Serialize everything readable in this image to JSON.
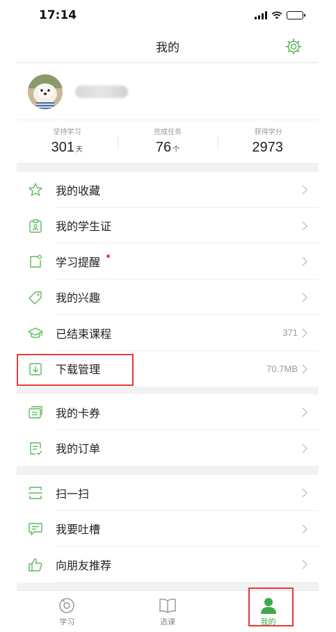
{
  "status_bar": {
    "time": "17:14"
  },
  "header": {
    "title": "我的"
  },
  "stats": [
    {
      "label": "坚持学习",
      "value": "301",
      "unit": "天"
    },
    {
      "label": "完成任务",
      "value": "76",
      "unit": "个"
    },
    {
      "label": "获得学分",
      "value": "2973",
      "unit": ""
    }
  ],
  "menu": {
    "group1": [
      {
        "label": "我的收藏",
        "icon": "star-icon",
        "value": ""
      },
      {
        "label": "我的学生证",
        "icon": "student-card-icon",
        "value": ""
      },
      {
        "label": "学习提醒",
        "icon": "reminder-icon",
        "value": ""
      },
      {
        "label": "我的兴趣",
        "icon": "tag-icon",
        "value": ""
      },
      {
        "label": "已结束课程",
        "icon": "graduation-cap-icon",
        "value": "371"
      },
      {
        "label": "下载管理",
        "icon": "download-icon",
        "value": "70.7MB"
      }
    ],
    "group2": [
      {
        "label": "我的卡券",
        "icon": "coupon-icon",
        "value": ""
      },
      {
        "label": "我的订单",
        "icon": "order-icon",
        "value": ""
      }
    ],
    "group3": [
      {
        "label": "扫一扫",
        "icon": "scan-icon",
        "value": ""
      },
      {
        "label": "我要吐槽",
        "icon": "feedback-icon",
        "value": ""
      },
      {
        "label": "向朋友推荐",
        "icon": "thumbs-up-icon",
        "value": ""
      }
    ]
  },
  "tabs": [
    {
      "label": "学习",
      "icon": "study-tab-icon",
      "active": false
    },
    {
      "label": "选课",
      "icon": "book-tab-icon",
      "active": false
    },
    {
      "label": "我的",
      "icon": "profile-tab-icon",
      "active": true
    }
  ],
  "colors": {
    "accent": "#3eab4a",
    "icon": "#5cb85c",
    "highlight": "#e23b3b",
    "reminder_dot": "#ee4444"
  }
}
